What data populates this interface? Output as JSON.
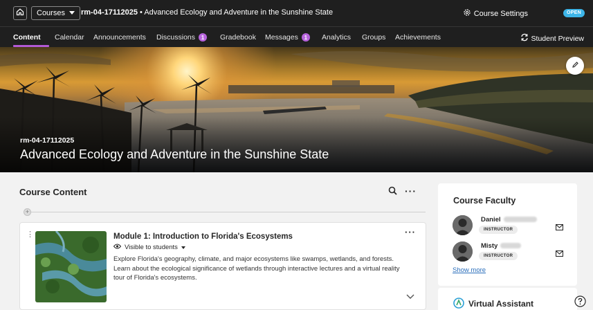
{
  "topbar": {
    "home_icon": "home-icon",
    "courses_label": "Courses",
    "course_code": "rm-04-17112025",
    "separator": " • ",
    "course_name": "Advanced Ecology and Adventure in the Sunshine State",
    "settings_label": "Course Settings",
    "status_badge": "OPEN"
  },
  "nav": {
    "items": [
      {
        "label": "Content",
        "active": true
      },
      {
        "label": "Calendar"
      },
      {
        "label": "Announcements"
      },
      {
        "label": "Discussions",
        "badge": "1"
      },
      {
        "label": "Gradebook"
      },
      {
        "label": "Messages",
        "badge": "1"
      },
      {
        "label": "Analytics"
      },
      {
        "label": "Groups"
      },
      {
        "label": "Achievements"
      }
    ],
    "student_preview": "Student Preview",
    "accent": "#b35ad6"
  },
  "banner": {
    "course_code": "rm-04-17112025",
    "title": "Advanced Ecology and Adventure in the Sunshine State"
  },
  "content": {
    "heading": "Course Content",
    "modules": [
      {
        "title": "Module 1: Introduction to Florida's Ecosystems",
        "visibility": "Visible to students",
        "description": "Explore Florida's geography, climate, and major ecosystems like swamps, wetlands, and forests. Learn about the ecological significance of wetlands through interactive lectures and a virtual reality tour of Florida's ecosystems."
      }
    ]
  },
  "faculty": {
    "heading": "Course Faculty",
    "people": [
      {
        "name": "Daniel",
        "role": "INSTRUCTOR"
      },
      {
        "name": "Misty",
        "role": "INSTRUCTOR"
      }
    ],
    "show_more": "Show more"
  },
  "assistant": {
    "label": "Virtual Assistant"
  }
}
